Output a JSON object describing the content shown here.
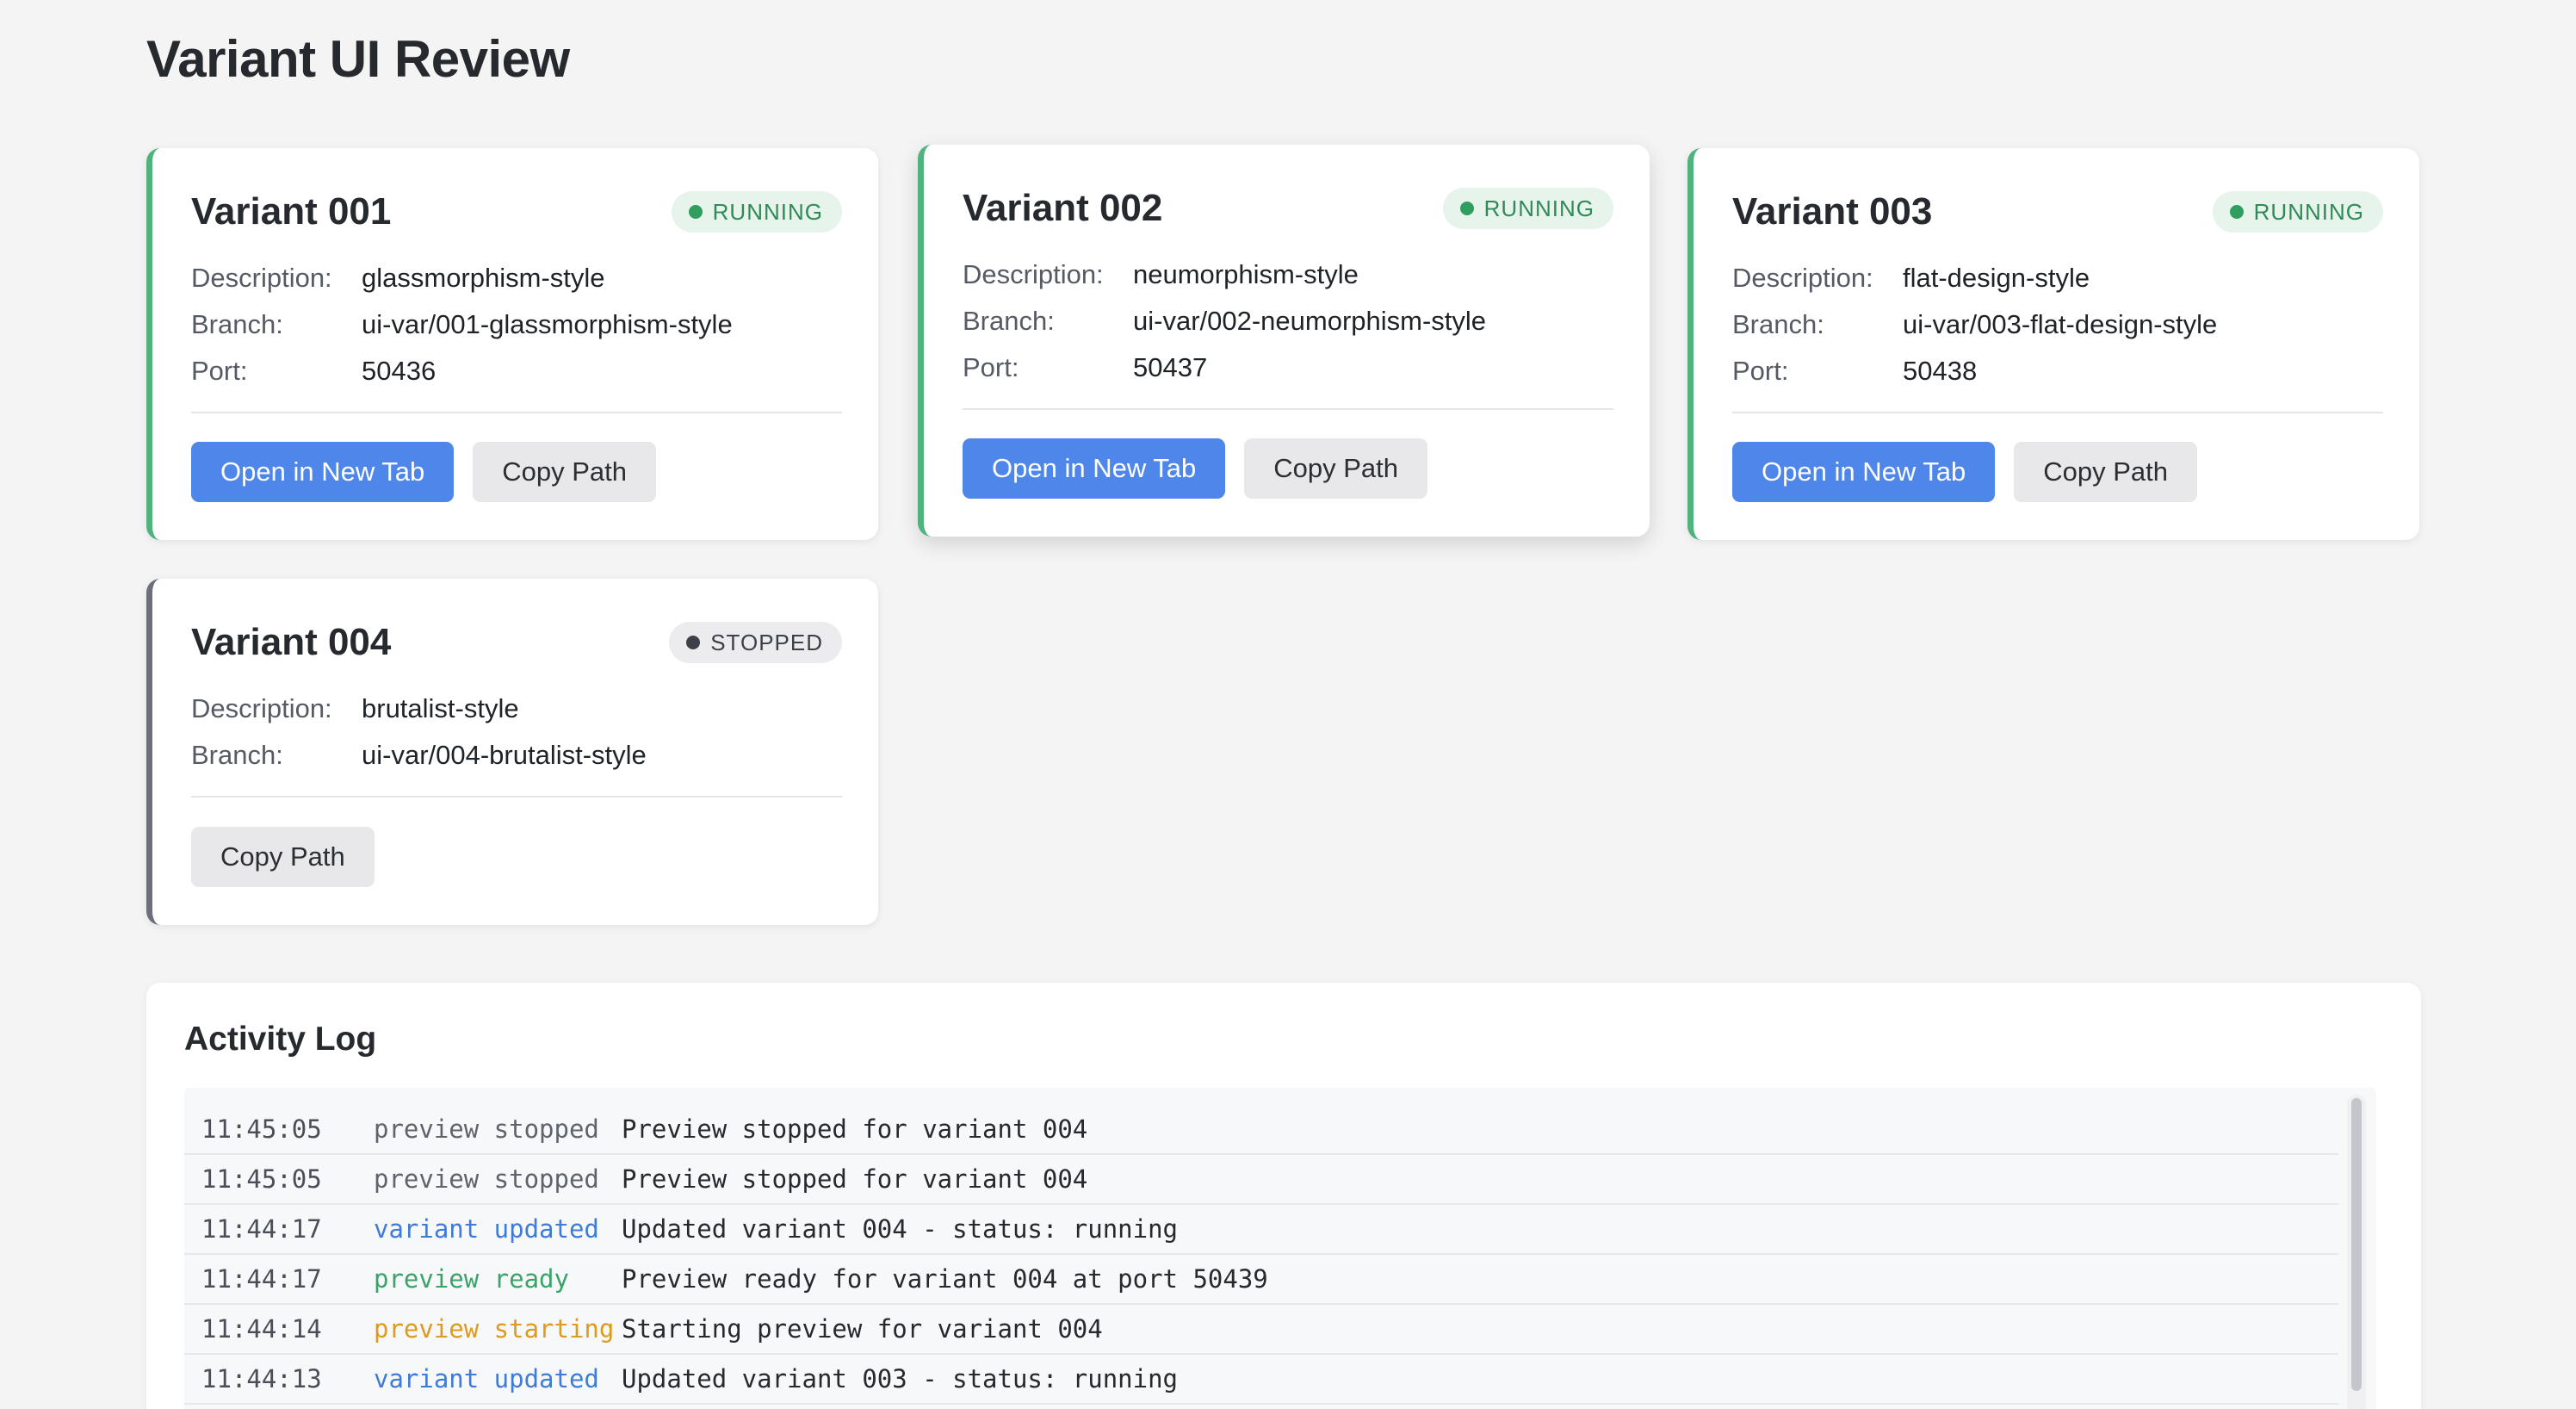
{
  "page": {
    "title": "Variant UI Review"
  },
  "labels": {
    "description": "Description:",
    "branch": "Branch:",
    "port": "Port:"
  },
  "buttons": {
    "open": "Open in New Tab",
    "copy": "Copy Path"
  },
  "colors": {
    "running": "#4fb37e",
    "stopped": "#6b6f7c",
    "primary": "#4f86ea"
  },
  "variants": [
    {
      "title": "Variant 001",
      "status": "RUNNING",
      "description": "glassmorphism-style",
      "branch": "ui-var/001-glassmorphism-style",
      "port": "50436"
    },
    {
      "title": "Variant 002",
      "status": "RUNNING",
      "description": "neumorphism-style",
      "branch": "ui-var/002-neumorphism-style",
      "port": "50437"
    },
    {
      "title": "Variant 003",
      "status": "RUNNING",
      "description": "flat-design-style",
      "branch": "ui-var/003-flat-design-style",
      "port": "50438"
    },
    {
      "title": "Variant 004",
      "status": "STOPPED",
      "description": "brutalist-style",
      "branch": "ui-var/004-brutalist-style"
    }
  ],
  "log": {
    "title": "Activity Log",
    "entries": [
      {
        "time": "11:45:05",
        "type": "preview stopped",
        "message": "Preview stopped for variant 004"
      },
      {
        "time": "11:45:05",
        "type": "preview stopped",
        "message": "Preview stopped for variant 004"
      },
      {
        "time": "11:44:17",
        "type": "variant updated",
        "message": "Updated variant 004 - status: running"
      },
      {
        "time": "11:44:17",
        "type": "preview ready",
        "message": "Preview ready for variant 004 at port 50439"
      },
      {
        "time": "11:44:14",
        "type": "preview starting",
        "message": "Starting preview for variant 004"
      },
      {
        "time": "11:44:13",
        "type": "variant updated",
        "message": "Updated variant 003 - status: running"
      }
    ]
  }
}
